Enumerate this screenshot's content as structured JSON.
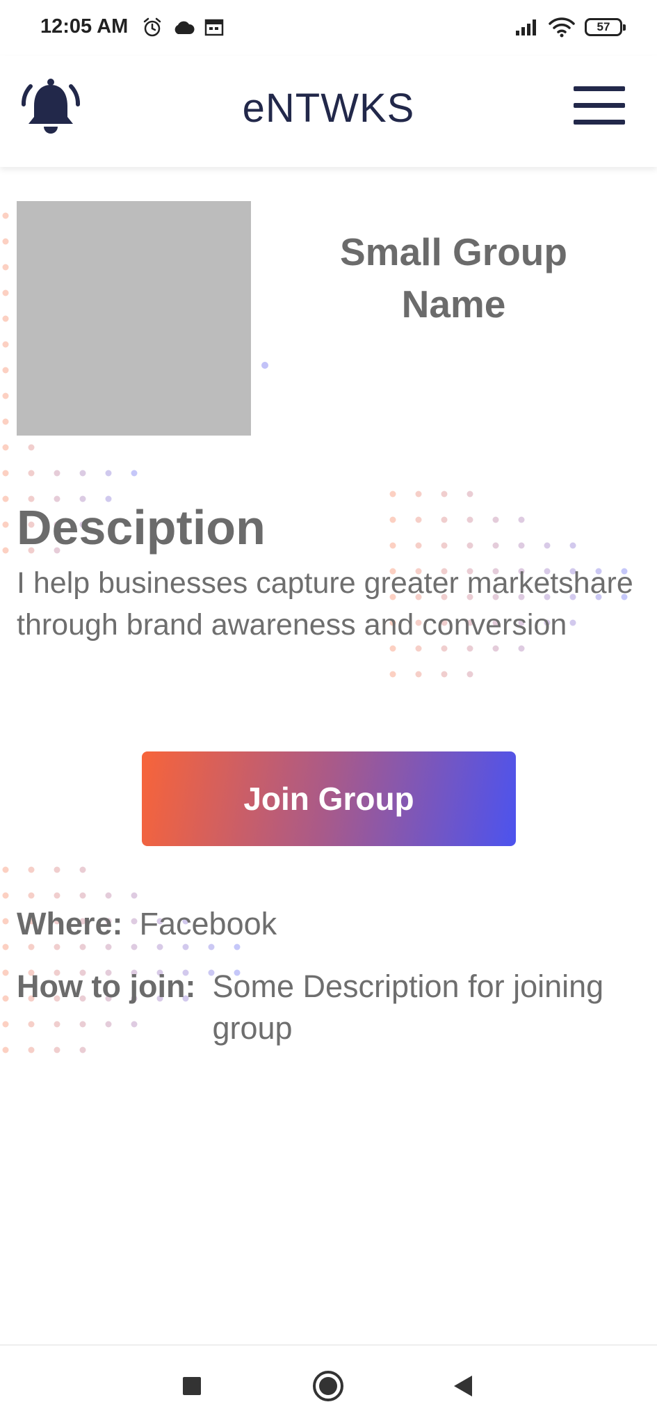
{
  "status_bar": {
    "time": "12:05 AM",
    "battery": "57",
    "left_icons": [
      "alarm-icon",
      "cloud-icon",
      "calendar-icon"
    ],
    "right_icons": [
      "signal-icon",
      "wifi-icon",
      "battery-icon"
    ]
  },
  "header": {
    "title": "eNTWKS",
    "bell_icon": "bell-icon",
    "menu_icon": "hamburger-menu-icon"
  },
  "group": {
    "name": "Small Group Name",
    "description_heading": "Desciption",
    "description": "I help businesses capture greater marketshare through brand awareness and conversion",
    "join_label": "Join Group",
    "where_label": "Where:",
    "where_value": "Facebook",
    "how_label": "How to join:",
    "how_value": "Some Description for joining group"
  },
  "nav_bar": {
    "icons": [
      "recents-square-icon",
      "home-circle-icon",
      "back-triangle-icon"
    ]
  },
  "colors": {
    "header_text": "#22284a",
    "body_text": "#6b6b6b",
    "button_gradient_start": "#f7643a",
    "button_gradient_end": "#4c53ee",
    "image_placeholder": "#bcbcbc"
  }
}
